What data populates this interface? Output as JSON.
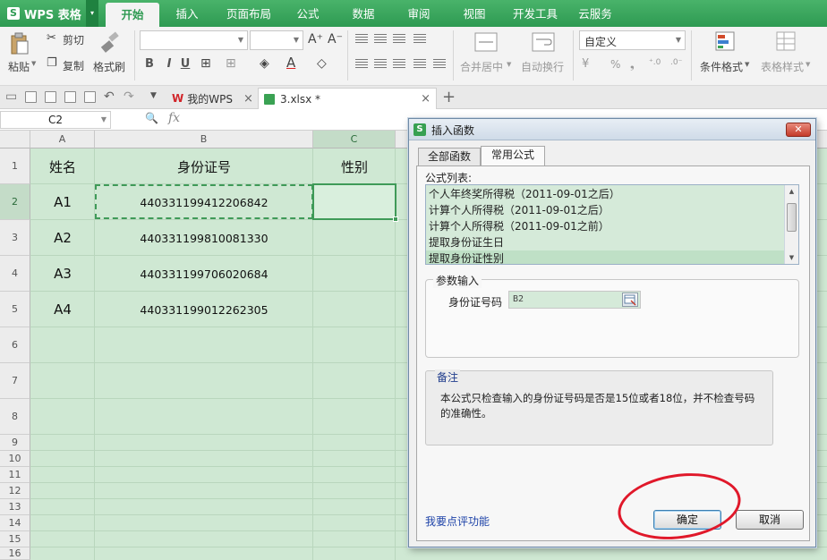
{
  "app": {
    "logo_text": "WPS 表格",
    "logo_mark": "S",
    "logo_arrow": "▾"
  },
  "menu_tabs": [
    "开始",
    "插入",
    "页面布局",
    "公式",
    "数据",
    "审阅",
    "视图",
    "开发工具",
    "云服务"
  ],
  "ribbon": {
    "paste": "粘贴",
    "cut": "剪切",
    "copy": "复制",
    "format_painter": "格式刷",
    "bold": "B",
    "italic": "I",
    "underline": "U",
    "increase_font": "A⁺",
    "decrease_font": "A⁻",
    "merge_center": "合并居中",
    "wrap_text": "自动换行",
    "number_format": "自定义",
    "percent": "%",
    "thousands": "❟",
    "inc_decimal": "⁺.0",
    "dec_decimal": ".0⁻",
    "conditional_format": "条件格式",
    "table_style": "表格样式"
  },
  "doc_tabs": [
    {
      "label": "我的WPS",
      "close": "×"
    },
    {
      "label": "3.xlsx *",
      "close": "×"
    }
  ],
  "new_tab": "+",
  "formula_bar": {
    "name_box": "C2",
    "fx": "fx",
    "zoom_glyph": "🔍"
  },
  "sheet": {
    "columns": [
      "A",
      "B",
      "C"
    ],
    "rows": [
      "1",
      "2",
      "3",
      "4",
      "5",
      "6",
      "7",
      "8",
      "9",
      "10",
      "11",
      "12",
      "13",
      "14",
      "15",
      "16"
    ],
    "cells": {
      "A1": "姓名",
      "B1": "身份证号",
      "C1": "性别",
      "A2": "A1",
      "B2": "440331199412206842",
      "A3": "A2",
      "B3": "440331199810081330",
      "A4": "A3",
      "B4": "440331199706020684",
      "A5": "A4",
      "B5": "440331199012262305"
    }
  },
  "dialog": {
    "title": "插入函数",
    "title_icon": "S",
    "close": "✕",
    "tabs": [
      "全部函数",
      "常用公式"
    ],
    "list_caption": "公式列表:",
    "list_items": [
      "个人年终奖所得税（2011-09-01之后）",
      "计算个人所得税（2011-09-01之后）",
      "计算个人所得税（2011-09-01之前）",
      "提取身份证生日",
      "提取身份证性别"
    ],
    "param_group": "参数输入",
    "param_label": "身份证号码",
    "param_value": "B2",
    "note_label": "备注",
    "note_text": "本公式只检查输入的身份证号码是否是15位或者18位，并不检查号码的准确性。",
    "feedback": "我要点评功能",
    "ok": "确定",
    "cancel": "取消",
    "scroll_up": "▲",
    "scroll_down": "▼"
  },
  "colors": {
    "accent": "#2e9a52",
    "sheet_bg": "#cfe8d3",
    "annotation": "#e0182a"
  }
}
